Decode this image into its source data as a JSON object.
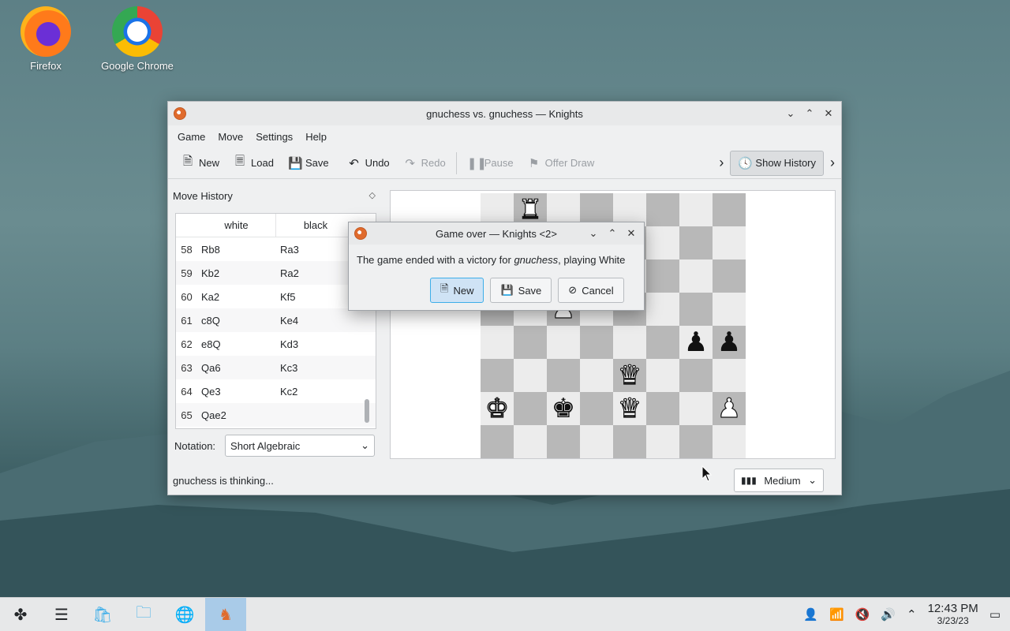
{
  "desktop": {
    "icons": [
      {
        "label": "Firefox"
      },
      {
        "label": "Google Chrome"
      }
    ]
  },
  "window": {
    "title": "gnuchess vs. gnuchess — Knights",
    "menu": [
      "Game",
      "Move",
      "Settings",
      "Help"
    ],
    "toolbar": {
      "new": "New",
      "load": "Load",
      "save": "Save",
      "undo": "Undo",
      "redo": "Redo",
      "pause": "Pause",
      "offer_draw": "Offer Draw",
      "show_history": "Show History"
    },
    "history": {
      "title": "Move History",
      "col_white": "white",
      "col_black": "black",
      "rows": [
        {
          "n": "58",
          "w": "Rb8",
          "b": "Ra3"
        },
        {
          "n": "59",
          "w": "Kb2",
          "b": "Ra2"
        },
        {
          "n": "60",
          "w": "Ka2",
          "b": "Kf5"
        },
        {
          "n": "61",
          "w": "c8Q",
          "b": "Ke4"
        },
        {
          "n": "62",
          "w": "e8Q",
          "b": "Kd3"
        },
        {
          "n": "63",
          "w": "Qa6",
          "b": "Kc3"
        },
        {
          "n": "64",
          "w": "Qe3",
          "b": "Kc2"
        },
        {
          "n": "65",
          "w": "Qae2",
          "b": ""
        }
      ],
      "notation_label": "Notation:",
      "notation_value": "Short Algebraic"
    },
    "status": "gnuchess is thinking...",
    "difficulty": "Medium"
  },
  "dialog": {
    "title": "Game over — Knights <2>",
    "msg_prefix": "The game ended with a victory for ",
    "msg_player": "gnuchess",
    "msg_suffix": ", playing White",
    "new": "New",
    "save": "Save",
    "cancel": "Cancel"
  },
  "taskbar": {
    "time": "12:43 PM",
    "date": "3/23/23"
  }
}
